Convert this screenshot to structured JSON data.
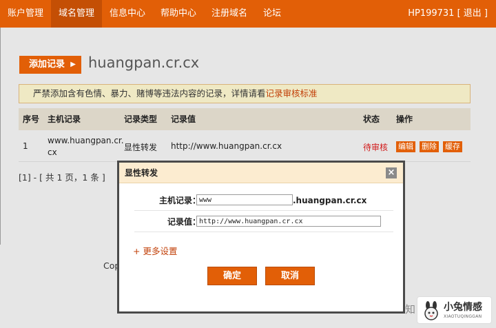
{
  "nav": {
    "items": [
      "账户管理",
      "域名管理",
      "信息中心",
      "帮助中心",
      "注册域名",
      "论坛"
    ],
    "active_index": 1,
    "user": "HP199731 [ 退出 ]"
  },
  "toolbar": {
    "add_label": "添加记录",
    "domain": "huangpan.cr.cx"
  },
  "warning": {
    "text": "严禁添加含有色情、暴力、赌博等违法内容的记录，详情请看",
    "link": "记录审核标准"
  },
  "table": {
    "headers": [
      "序号",
      "主机记录",
      "记录类型",
      "记录值",
      "状态",
      "操作"
    ],
    "rows": [
      {
        "index": "1",
        "host_line1": "www.huangpan.cr.",
        "host_line2": "cx",
        "type": "显性转发",
        "value": "http://www.huangpan.cr.cx",
        "status": "待审核",
        "actions": [
          "编辑",
          "删除",
          "缓存"
        ]
      }
    ]
  },
  "pager": "[1] - [ 共 1 页，1 条 ]",
  "footer_fragment": "Cop",
  "dialog": {
    "title": "显性转发",
    "close_symbol": "×",
    "host_label": "主机记录：",
    "host_value": "www",
    "host_suffix": ".huangpan.cr.cx",
    "value_label": "记录值：",
    "value_value": "http://www.huangpan.cr.cx",
    "more_settings": "+ 更多设置",
    "confirm": "确定",
    "cancel": "取消"
  },
  "watermark": {
    "zhi": "知",
    "name": "小兔情感",
    "sub": "XIAOTUQINGGAN"
  },
  "colors": {
    "accent": "#e25f07",
    "nav_active": "#c44f05",
    "status_pending": "#d11919",
    "warning_bg": "#efe9c4"
  }
}
